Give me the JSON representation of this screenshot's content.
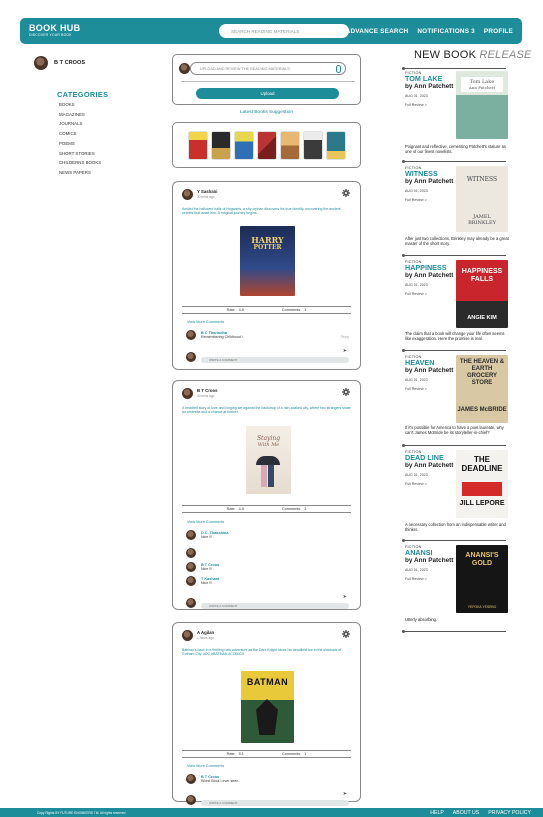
{
  "header": {
    "brand": "BOOK HUB",
    "tagline": "DISCOVER YOUR BOOK",
    "search_placeholder": "SEARCH READING MATERIALS",
    "nav": {
      "advance_search": "ADVANCE SEARCH",
      "notifications": "NOTIFICATIONS 3",
      "profile": "PROFILE"
    }
  },
  "sidebar": {
    "user_name": "B T CROOS",
    "categories_title": "CATEGORIES",
    "categories": [
      "BOOKS",
      "MAGAZINES",
      "JOURNALS",
      "COMICS",
      "POEMS",
      "SHORT STORIES",
      "CHILDERNS BOOKS",
      "NEWS PAPERS"
    ]
  },
  "upload": {
    "placeholder": "UPLOAD AND REVIEW THE READING MATERIALS",
    "button": "Upload"
  },
  "suggestions": {
    "title": "Latest Books Suggestion",
    "colors": [
      "#c9302c",
      "#2a2a2a",
      "#2e6fb5",
      "#7a1e1e",
      "#c18a4a",
      "#3b3b3b",
      "#2b7a8a"
    ],
    "covers": [
      {
        "icon": "book-cover-1-icon"
      },
      {
        "icon": "book-cover-2-icon"
      },
      {
        "icon": "book-cover-flying-solo-icon"
      },
      {
        "icon": "book-cover-4-icon"
      },
      {
        "icon": "book-cover-5-icon"
      },
      {
        "icon": "book-cover-6-icon"
      },
      {
        "icon": "book-cover-7-icon"
      }
    ]
  },
  "posts": [
    {
      "user": "Y Sashani",
      "time": "30 mins ago",
      "text": "Amidst the hallowed halls of Hogwarts, a shy orphan discovers his true identity, uncovering the ancient secrets that await him. A magical journey begins...",
      "cover": {
        "top": "HARRY",
        "bottom": "POTTER",
        "color": "#1d2b55"
      },
      "rate_label": "Rate",
      "rate": "4.5",
      "comments_label": "Comments",
      "comments": "1",
      "view_more": "View More Comments",
      "comments_list": [
        {
          "name": "B C Tharindha",
          "text": "Remembering Childhood !",
          "reply": "Reply"
        }
      ],
      "comment_placeholder": "WRITE A COMMENT"
    },
    {
      "user": "B T Croos",
      "time": "40 mins ago",
      "text": "A heartfelt story of love and longing set against the backdrop of a rain-soaked city, where two strangers share an umbrella and a chance at forever.",
      "cover": {
        "top": "Staying",
        "bottom": "With Me",
        "color": "#f2ede6"
      },
      "rate_label": "Rate",
      "rate": "4.5",
      "comments_label": "Comments",
      "comments": "3",
      "view_more": "View More Comments",
      "comments_list": [
        {
          "name": "D.C. Thakshina",
          "text": "Nice !!!"
        },
        {
          "name": "",
          "text": ""
        },
        {
          "name": "B T Croos",
          "text": "Nice !!!"
        },
        {
          "name": "T Kashani",
          "text": "Nice !!!"
        }
      ],
      "comment_placeholder": "WRITE A COMMENT"
    },
    {
      "user": "A Agilan",
      "time": "1 hours ago",
      "text": "Batman's back in a thrilling new adventure as the Dark Knight faces his deadliest foe in the shadows of Gotham City. #DC #BATMAN #COMICS",
      "cover": {
        "top": "BATMAN",
        "bottom": "",
        "color": "#e8c93a"
      },
      "rate_label": "Rate",
      "rate": "5.1",
      "comments_label": "Comments",
      "comments": "1",
      "view_more": "View More Comments",
      "comments_list": [
        {
          "name": "B T Croos",
          "text": "Worst Book I ever seen."
        }
      ],
      "comment_placeholder": "WRITE A COMMENT"
    }
  ],
  "new_books": {
    "title_main": "NEW BOOK",
    "title_italic": "RELEASE",
    "items": [
      {
        "genre": "FICTION",
        "name": "TOM LAKE",
        "author": "by Ann Patchett",
        "date": "AUG 01, 2023",
        "full_review": "Full Review >",
        "desc": "Poignant and reflective, cementing Patchett's stature as one of our finest novelists.",
        "cover_title": "Tom Lake",
        "cover_author": "Ann Patchett",
        "cover_color": "#b9d3c4"
      },
      {
        "genre": "FICTION",
        "name": "WITNESS",
        "author": "by Ann Patchett",
        "date": "AUG 01, 2023",
        "full_review": "Full Review >",
        "desc": "After just two collections, Brinkley may already be a great master of the short story.",
        "cover_title": "WITNESS",
        "cover_author": "JAMEL BRINKLEY",
        "cover_color": "#e8e4dc"
      },
      {
        "genre": "FICTION",
        "name": "HAPPINESS",
        "author": "by Ann Patchett",
        "date": "AUG 01, 2023",
        "full_review": "Full Review >",
        "desc": "The claim that a book will change your life often seems like exaggeration. Here the promise is real.",
        "cover_title": "HAPPINESS FALLS",
        "cover_author": "ANGIE KIM",
        "cover_color": "#c8262c"
      },
      {
        "genre": "FICTION",
        "name": "HEAVEN",
        "author": "by Ann Patchett",
        "date": "AUG 01, 2023",
        "full_review": "Full Review >",
        "desc": "If it's possible for America to have a poet laureate, why can't James McBride be its storyteller-in-chief?",
        "cover_title": "THE HEAVEN & EARTH GROCERY STORE",
        "cover_author": "JAMES McBRIDE",
        "cover_color": "#d8c9a4"
      },
      {
        "genre": "FICTION",
        "name": "DEAD LINE",
        "author": "by Ann Patchett",
        "date": "AUG 01, 2023",
        "full_review": "Full Review >",
        "desc": "A necessary collection from an indispensable writer and thinker.",
        "cover_title": "THE DEADLINE",
        "cover_author": "JILL LEPORE",
        "cover_color": "#f4f2ee"
      },
      {
        "genre": "FICTION",
        "name": "ANANSI",
        "author": "by Ann Patchett",
        "date": "AUG 01, 2023",
        "full_review": "Full Review >",
        "desc": "Utterly absorbing.",
        "cover_title": "ANANSI'S GOLD",
        "cover_author": "YEPOKA YESEBO",
        "cover_color": "#151515"
      }
    ]
  },
  "footer": {
    "copyright": "Copy Rights BY FUTURE ENGINEERS TM. All rights reserved",
    "links": [
      "HELP",
      "ABOUT US",
      "PRIVACY POLICY"
    ]
  }
}
